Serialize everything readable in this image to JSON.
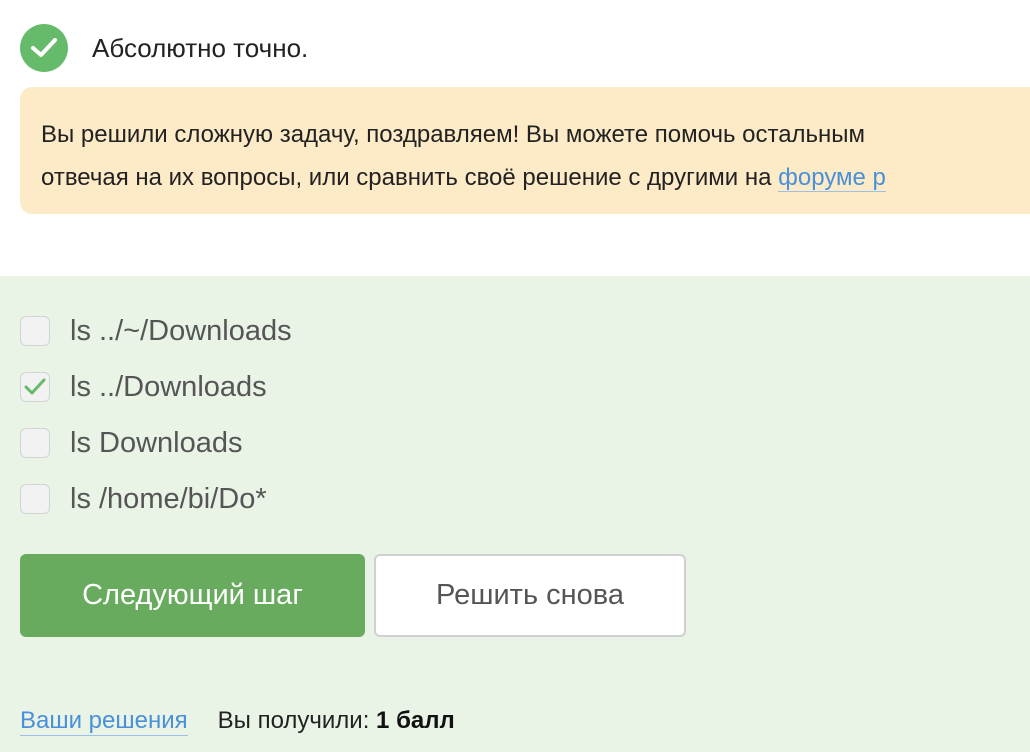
{
  "status": {
    "icon": "check-circle-icon",
    "text": "Абсолютно точно."
  },
  "banner": {
    "line1": "Вы решили сложную задачу, поздравляем! Вы можете помочь остальным",
    "line2_text": "отвечая на их вопросы, или сравнить своё решение с другими на ",
    "line2_link": "форуме р"
  },
  "options": [
    {
      "label": "ls ../~/Downloads",
      "checked": false
    },
    {
      "label": "ls ../Downloads",
      "checked": true
    },
    {
      "label": "ls Downloads",
      "checked": false
    },
    {
      "label": "ls /home/bi/Do*",
      "checked": false
    }
  ],
  "actions": {
    "next_label": "Следующий шаг",
    "retry_label": "Решить снова"
  },
  "footer": {
    "solutions_link": "Ваши решения",
    "score_prefix": "Вы получили: ",
    "score_value": "1 балл"
  },
  "colors": {
    "success": "#66bb6a",
    "banner_bg": "#fdebc8",
    "area_bg": "#e9f4e7",
    "primary_button": "#68ab5f",
    "link": "#4a90d9"
  }
}
